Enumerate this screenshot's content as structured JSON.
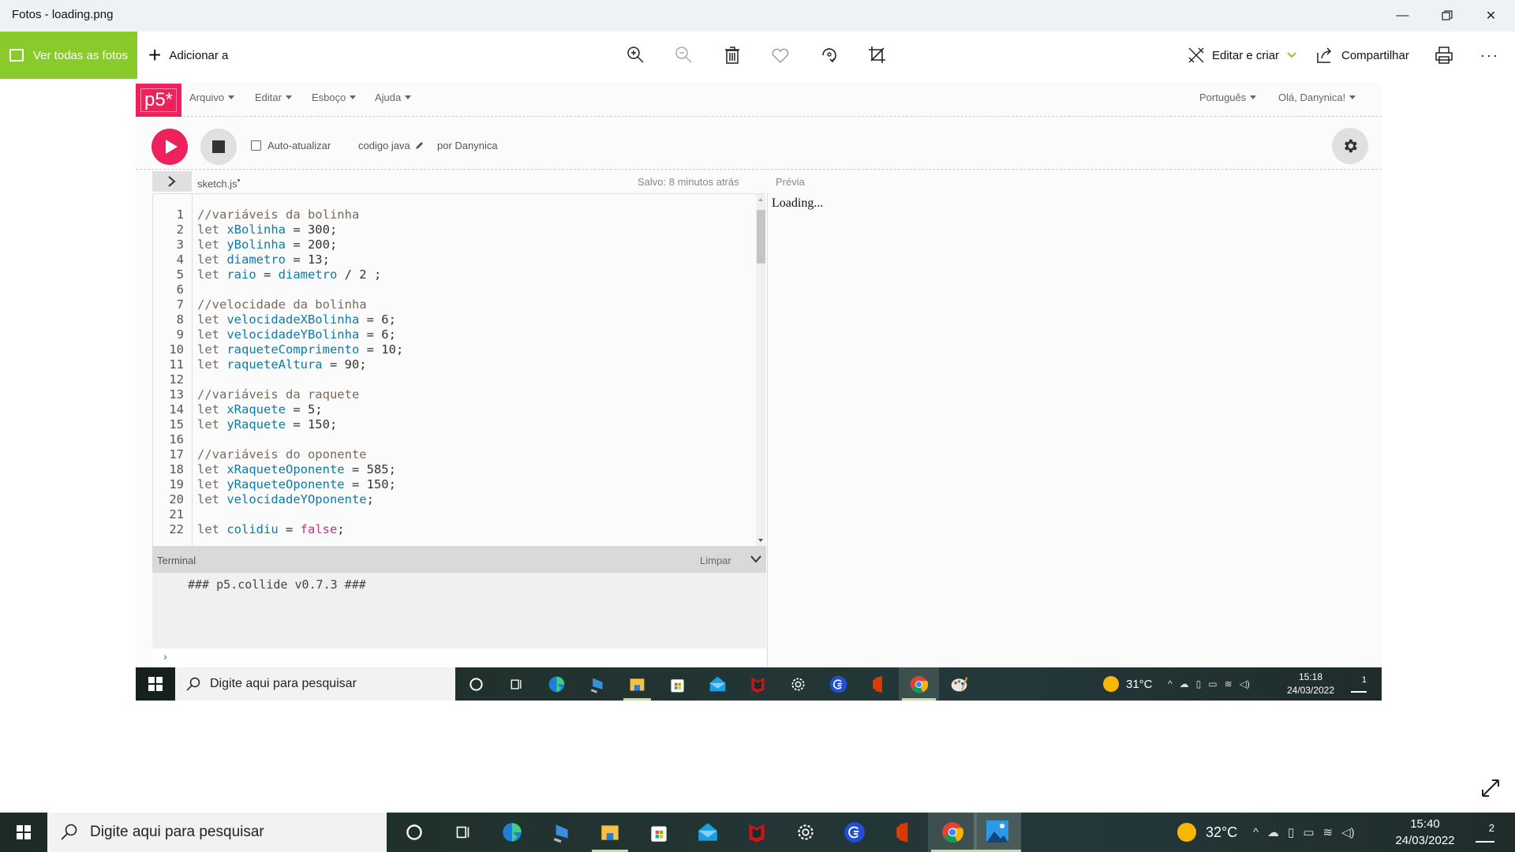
{
  "window": {
    "title": "Fotos - loading.png",
    "controls": {
      "minimize": "—",
      "maximize": "❐",
      "close": "✕"
    }
  },
  "toolbar": {
    "see_all_label": "Ver todas as fotos",
    "add_to_label": "Adicionar a",
    "icons": [
      "zoom-in-icon",
      "zoom-out-icon",
      "delete-icon",
      "favorite-icon",
      "rotate-icon",
      "crop-icon"
    ],
    "edit_create_label": "Editar e criar",
    "share_label": "Compartilhar",
    "print_icon": "print-icon",
    "more_label": "···",
    "accent_color": "#8acb2c"
  },
  "p5": {
    "logo": "p5*",
    "brand_color": "#ed225d",
    "menus": [
      {
        "label": "Arquivo"
      },
      {
        "label": "Editar"
      },
      {
        "label": "Esboço"
      },
      {
        "label": "Ajuda"
      }
    ],
    "language": "Português",
    "user_greeting": "Olá, Danynica!",
    "auto_refresh_label": "Auto-atualizar",
    "auto_refresh_checked": false,
    "sketch_name": "codigo java",
    "author": "por Danynica",
    "file_tab": "sketch.js",
    "unsaved_dot": "•",
    "saved_status": "Salvo: 8 minutos atrás",
    "preview_label": "Prévia",
    "preview_text": "Loading...",
    "code": [
      {
        "n": "1",
        "tokens": [
          [
            "c-comment",
            "//variáveis da bolinha"
          ]
        ]
      },
      {
        "n": "2",
        "tokens": [
          [
            "c-kw",
            "let "
          ],
          [
            "c-var",
            "xBolinha"
          ],
          [
            "c-num",
            " = 300;"
          ]
        ]
      },
      {
        "n": "3",
        "tokens": [
          [
            "c-kw",
            "let "
          ],
          [
            "c-var",
            "yBolinha"
          ],
          [
            "c-num",
            " = 200;"
          ]
        ]
      },
      {
        "n": "4",
        "tokens": [
          [
            "c-kw",
            "let "
          ],
          [
            "c-var",
            "diametro"
          ],
          [
            "c-num",
            " = 13;"
          ]
        ]
      },
      {
        "n": "5",
        "tokens": [
          [
            "c-kw",
            "let "
          ],
          [
            "c-var",
            "raio"
          ],
          [
            "c-num",
            " = "
          ],
          [
            "c-var",
            "diametro"
          ],
          [
            "c-num",
            " / 2 ;"
          ]
        ]
      },
      {
        "n": "6",
        "tokens": []
      },
      {
        "n": "7",
        "tokens": [
          [
            "c-comment",
            "//velocidade da bolinha"
          ]
        ]
      },
      {
        "n": "8",
        "tokens": [
          [
            "c-kw",
            "let "
          ],
          [
            "c-var",
            "velocidadeXBolinha"
          ],
          [
            "c-num",
            " = 6;"
          ]
        ]
      },
      {
        "n": "9",
        "tokens": [
          [
            "c-kw",
            "let "
          ],
          [
            "c-var",
            "velocidadeYBolinha"
          ],
          [
            "c-num",
            " = 6;"
          ]
        ]
      },
      {
        "n": "10",
        "tokens": [
          [
            "c-kw",
            "let "
          ],
          [
            "c-var",
            "raqueteComprimento"
          ],
          [
            "c-num",
            " = 10;"
          ]
        ]
      },
      {
        "n": "11",
        "tokens": [
          [
            "c-kw",
            "let "
          ],
          [
            "c-var",
            "raqueteAltura"
          ],
          [
            "c-num",
            " = 90;"
          ]
        ]
      },
      {
        "n": "12",
        "tokens": []
      },
      {
        "n": "13",
        "tokens": [
          [
            "c-comment",
            "//variáveis da raquete"
          ]
        ]
      },
      {
        "n": "14",
        "tokens": [
          [
            "c-kw",
            "let "
          ],
          [
            "c-var",
            "xRaquete"
          ],
          [
            "c-num",
            " = 5;"
          ]
        ]
      },
      {
        "n": "15",
        "tokens": [
          [
            "c-kw",
            "let "
          ],
          [
            "c-var",
            "yRaquete"
          ],
          [
            "c-num",
            " = 150;"
          ]
        ]
      },
      {
        "n": "16",
        "tokens": []
      },
      {
        "n": "17",
        "tokens": [
          [
            "c-comment",
            "//variáveis do oponente"
          ]
        ]
      },
      {
        "n": "18",
        "tokens": [
          [
            "c-kw",
            "let "
          ],
          [
            "c-var",
            "xRaqueteOponente"
          ],
          [
            "c-num",
            " = 585;"
          ]
        ]
      },
      {
        "n": "19",
        "tokens": [
          [
            "c-kw",
            "let "
          ],
          [
            "c-var",
            "yRaqueteOponente"
          ],
          [
            "c-num",
            " = 150;"
          ]
        ]
      },
      {
        "n": "20",
        "tokens": [
          [
            "c-kw",
            "let "
          ],
          [
            "c-var",
            "velocidadeYOponente"
          ],
          [
            "c-num",
            ";"
          ]
        ]
      },
      {
        "n": "21",
        "tokens": []
      },
      {
        "n": "22",
        "tokens": [
          [
            "c-kw",
            "let "
          ],
          [
            "c-var",
            "colidiu"
          ],
          [
            "c-num",
            " = "
          ],
          [
            "c-bool",
            "false"
          ],
          [
            "c-num",
            ";"
          ]
        ]
      }
    ],
    "terminal": {
      "title": "Terminal",
      "clear_label": "Limpar",
      "log": "### p5.collide v0.7.3 ###",
      "prompt": "›"
    }
  },
  "inner_taskbar": {
    "search_placeholder": "Digite aqui para pesquisar",
    "temperature": "31°C",
    "time": "15:18",
    "date": "24/03/2022",
    "notifications": "1"
  },
  "outer_taskbar": {
    "search_placeholder": "Digite aqui para pesquisar",
    "temperature": "32°C",
    "time": "15:40",
    "date": "24/03/2022",
    "notifications": "2"
  },
  "taskbar_apps": [
    "cortana-icon",
    "task-view-icon",
    "edge-icon",
    "remote-desktop-icon",
    "file-explorer-icon",
    "store-icon",
    "mail-icon",
    "mcafee-icon",
    "settings-icon",
    "search-app-icon",
    "office-icon",
    "chrome-icon"
  ]
}
